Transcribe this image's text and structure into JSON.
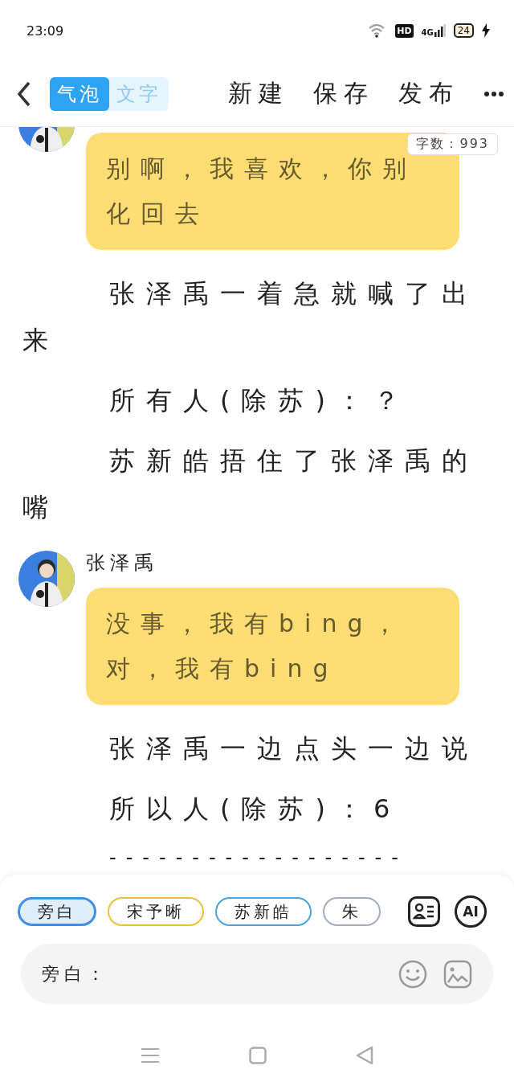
{
  "status_bar": {
    "time": "23:09",
    "hd_label": "HD",
    "network": "4G",
    "battery": "24"
  },
  "header": {
    "modes": [
      {
        "label": "气泡",
        "selected": true
      },
      {
        "label": "文字",
        "selected": false
      }
    ],
    "actions": [
      "新建",
      "保存",
      "发布"
    ]
  },
  "word_count": "字数：993",
  "feed": [
    {
      "kind": "bubble",
      "text": "别啊，我喜欢，你别化回去"
    },
    {
      "kind": "narration",
      "text": "张泽禹一着急就喊了出来"
    },
    {
      "kind": "narration",
      "text": "所有人(除苏)：？"
    },
    {
      "kind": "narration",
      "text": "苏新皓捂住了张泽禹的嘴"
    },
    {
      "kind": "bubble",
      "name": "张泽禹",
      "text": "没事，我有bing，对，我有bing"
    },
    {
      "kind": "narration",
      "text": "张泽禹一边点头一边说"
    },
    {
      "kind": "narration",
      "text": "所以人(除苏)：6"
    },
    {
      "kind": "divider",
      "text": "------------------"
    }
  ],
  "roles": [
    {
      "label": "旁白",
      "selected": true,
      "color": "#3d8fe8"
    },
    {
      "label": "宋予晰",
      "selected": false,
      "color": "#e8c23a"
    },
    {
      "label": "苏新皓",
      "selected": false,
      "color": "#4aa3e0"
    },
    {
      "label": "朱",
      "selected": false,
      "color": "#a3adbd"
    }
  ],
  "ai_label": "AI",
  "input": {
    "prefix": "旁白："
  }
}
